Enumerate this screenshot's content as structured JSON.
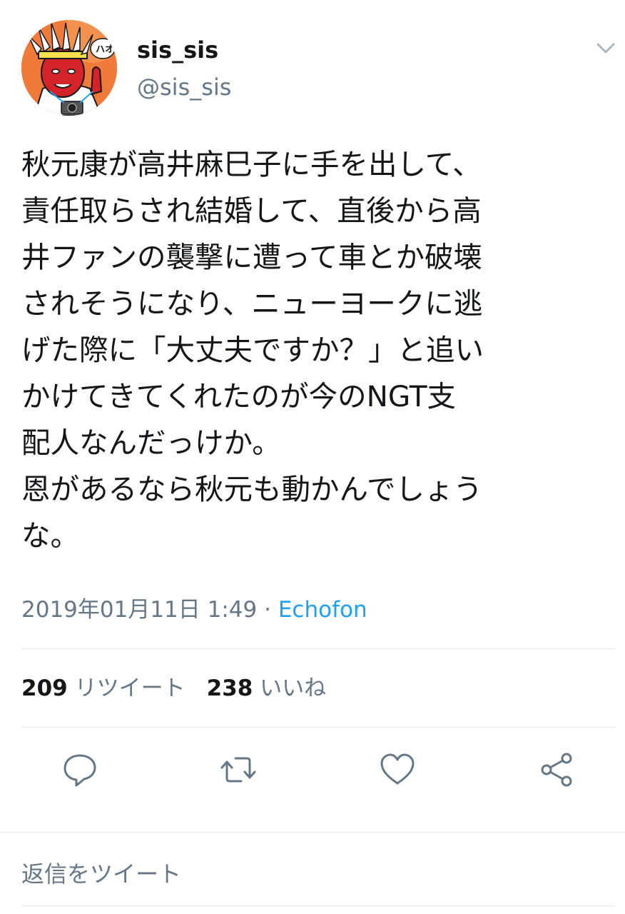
{
  "author": {
    "display_name": "sis_sis",
    "handle": "@sis_sis",
    "avatar_speech": "ハオ!"
  },
  "tweet": {
    "text": "秋元康が高井麻巳子に手を出して、\n責任取らされ結婚して、直後から高\n井ファンの襲撃に遭って車とか破壊\nされそうになり、ニューヨークに逃\nげた際に「大丈夫ですか？」と追い\nかけてきてくれたのが今のNGT支\n配人なんだっけか。\n恩があるなら秋元も動かんでしょう\nな。",
    "timestamp": "2019年01月11日 1:49",
    "separator": "·",
    "source": "Echofon"
  },
  "stats": {
    "retweets_count": "209",
    "retweets_label": "リツイート",
    "likes_count": "238",
    "likes_label": "いいね"
  },
  "actions": {
    "reply_icon": "reply-icon",
    "retweet_icon": "retweet-icon",
    "like_icon": "heart-icon",
    "share_icon": "share-icon"
  },
  "reply_box": {
    "placeholder": "返信をツイート"
  },
  "colors": {
    "text": "#14171a",
    "secondary": "#657786",
    "accent": "#1da1f2",
    "divider": "#e1e8ed"
  }
}
